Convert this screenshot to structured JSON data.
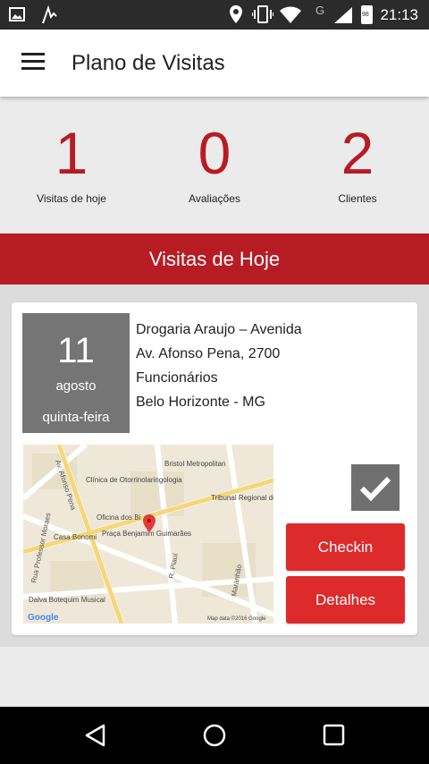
{
  "status_bar": {
    "time": "21:13",
    "icons": [
      "image-icon",
      "activity-icon",
      "location-icon",
      "vibrate-icon",
      "wifi-icon",
      "signal-icon",
      "battery-icon"
    ],
    "network_type": "G",
    "battery_level": "98"
  },
  "app_bar": {
    "title": "Plano de Visitas",
    "menu_icon": "hamburger-menu-icon"
  },
  "stats": [
    {
      "value": "1",
      "label": "Visitas de hoje"
    },
    {
      "value": "0",
      "label": "Avaliações"
    },
    {
      "value": "2",
      "label": "Clientes"
    }
  ],
  "section": {
    "title": "Visitas de Hoje"
  },
  "visit": {
    "day": "11",
    "month": "agosto",
    "weekday": "quinta-feira",
    "address": [
      "Drogaria Araujo – Avenida",
      "Av. Afonso Pena, 2700",
      "Funcionários",
      "Belo Horizonte - MG"
    ],
    "map_labels": {
      "bristol": "Bristol Metropolitan",
      "clinica": "Clínica de Otorrinolaringologia",
      "tribunal": "Tribunal Regional do Trabalho",
      "oficina": "Oficina dos Bi",
      "casa": "Casa Bonomi",
      "praca": "Praça Benjamim Guimarães",
      "dalva": "Dalva Botequim Musical",
      "google": "Google",
      "mapdata": "Map data ©2016 Google",
      "afonso": "Av. Afonso Pena",
      "professor": "Rua Professor Moraes",
      "piaui": "R. Piauí",
      "maranhao": "Maranhão"
    },
    "checkin_label": "Checkin",
    "details_label": "Detalhes",
    "done_icon": "checkmark-icon"
  },
  "nav_bar": {
    "back_icon": "back-triangle-icon",
    "home_icon": "home-circle-icon",
    "recents_icon": "recents-square-icon"
  },
  "colors": {
    "accent": "#b71c24",
    "button": "#dd2a2a",
    "date_box": "#757575"
  }
}
